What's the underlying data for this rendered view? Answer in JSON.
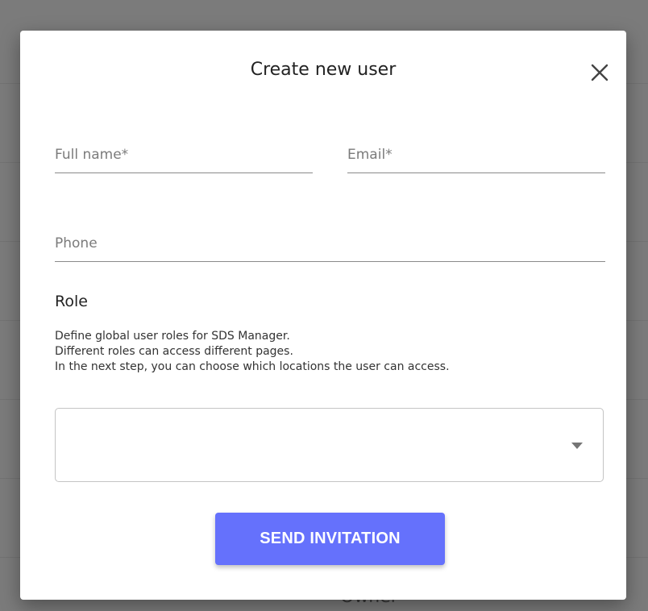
{
  "backdrop": {
    "partial_text": "Owner"
  },
  "dialog": {
    "title": "Create new user",
    "close_icon": "close-icon",
    "fields": {
      "full_name": {
        "placeholder": "Full name*",
        "value": ""
      },
      "email": {
        "placeholder": "Email*",
        "value": ""
      },
      "phone": {
        "placeholder": "Phone",
        "value": ""
      }
    },
    "role": {
      "heading": "Role",
      "description": [
        "Define global user roles for SDS Manager.",
        "Different roles can access different pages.",
        "In the next step, you can choose which locations the user can access."
      ],
      "selected": "",
      "caret_icon": "caret-down-icon"
    },
    "send_label": "SEND INVITATION"
  },
  "colors": {
    "accent": "#6571fc",
    "overlay": "#7b7b7b",
    "surface": "#ffffff",
    "field_border": "#8a8a8a"
  }
}
